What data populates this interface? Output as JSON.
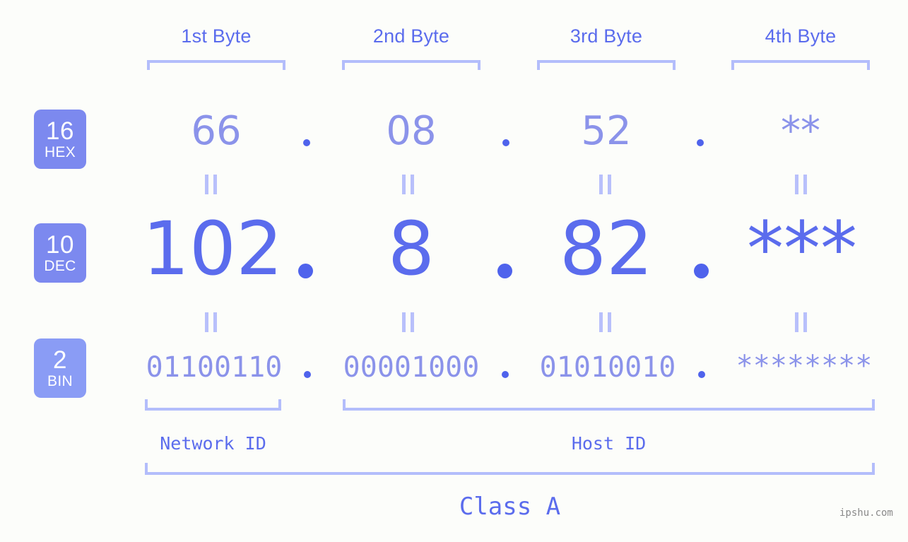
{
  "meta": {
    "background_color": "#fcfdfa",
    "accent_color": "#5b6ced",
    "light_accent_color": "#8b93ea",
    "bracket_color": "#b3bdfb",
    "badge_color": "#7c89ef",
    "badge_color_alt": "#8a9cf5"
  },
  "byte_headers": [
    {
      "label": "1st Byte"
    },
    {
      "label": "2nd Byte"
    },
    {
      "label": "3rd Byte"
    },
    {
      "label": "4th Byte"
    }
  ],
  "rows": [
    {
      "badge_number": "16",
      "badge_name": "HEX",
      "values": [
        "66",
        "08",
        "52",
        "**"
      ],
      "separator": "."
    },
    {
      "badge_number": "10",
      "badge_name": "DEC",
      "values": [
        "102",
        "8",
        "82",
        "***"
      ],
      "separator": "."
    },
    {
      "badge_number": "2",
      "badge_name": "BIN",
      "values": [
        "01100110",
        "00001000",
        "01010010",
        "********"
      ],
      "separator": "."
    }
  ],
  "equals_symbol": "||",
  "id_sections": [
    {
      "label": "Network ID"
    },
    {
      "label": "Host ID"
    }
  ],
  "class_label": "Class A",
  "watermark": "ipshu.com"
}
